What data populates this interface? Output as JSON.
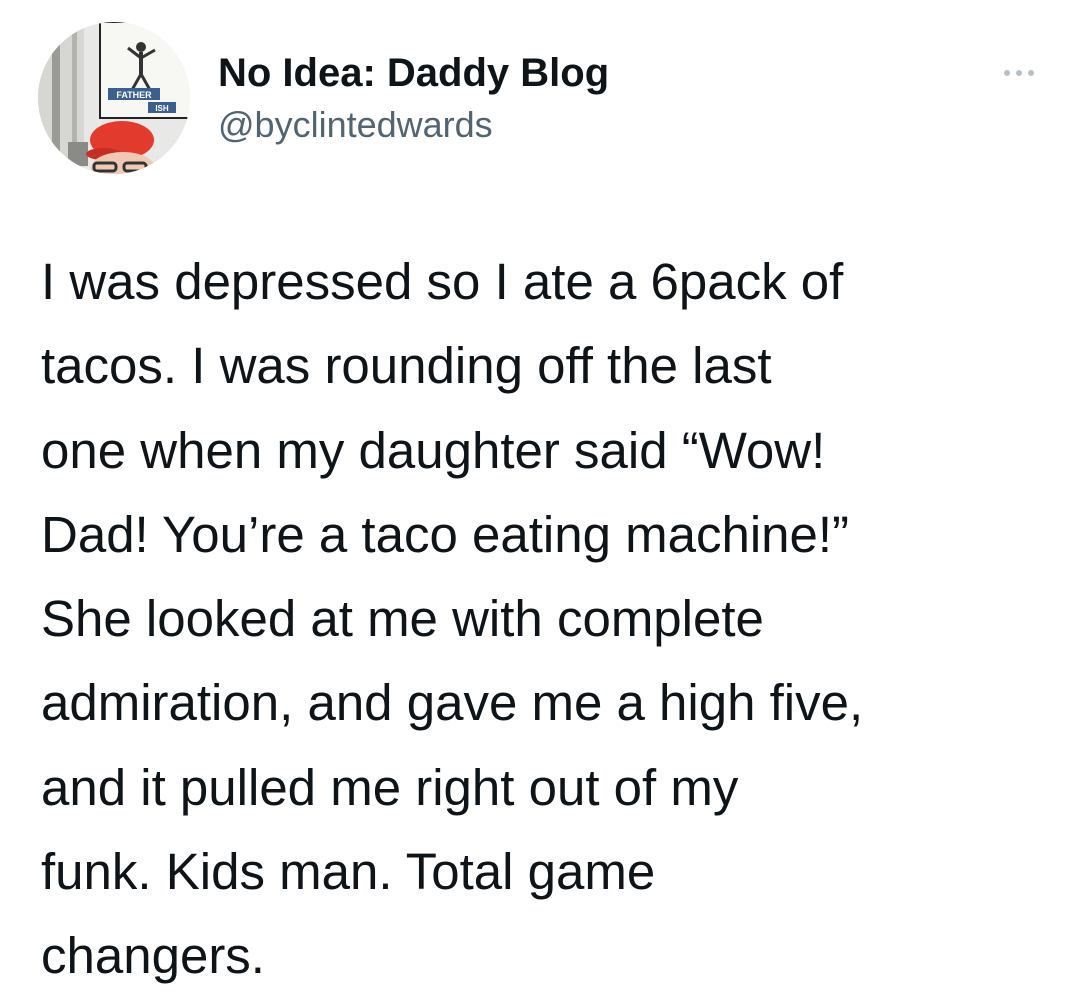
{
  "tweet": {
    "author": {
      "display_name": "No Idea: Daddy Blog",
      "handle": "@byclintedwards",
      "avatar_icon": "profile-photo-with-red-cap-and-fatherish-poster"
    },
    "menu_icon": "more-options-icon",
    "lines": [
      "I was depressed so I ate a 6pack of",
      "tacos. I was rounding off the last",
      "one when my daughter said “Wow!",
      "Dad! You’re a taco eating machine!”",
      "She looked at me with complete",
      "admiration, and gave me a high five,",
      "and it pulled me right out of my",
      "funk. Kids man. Total game",
      "changers."
    ],
    "avatar_poster": {
      "top_text": "FATHER",
      "bottom_text": "ISH"
    }
  },
  "colors": {
    "text_primary": "#0f1419",
    "text_secondary": "#536471",
    "menu_dots": "#b8c0c7",
    "cap_red": "#e23a2d"
  }
}
